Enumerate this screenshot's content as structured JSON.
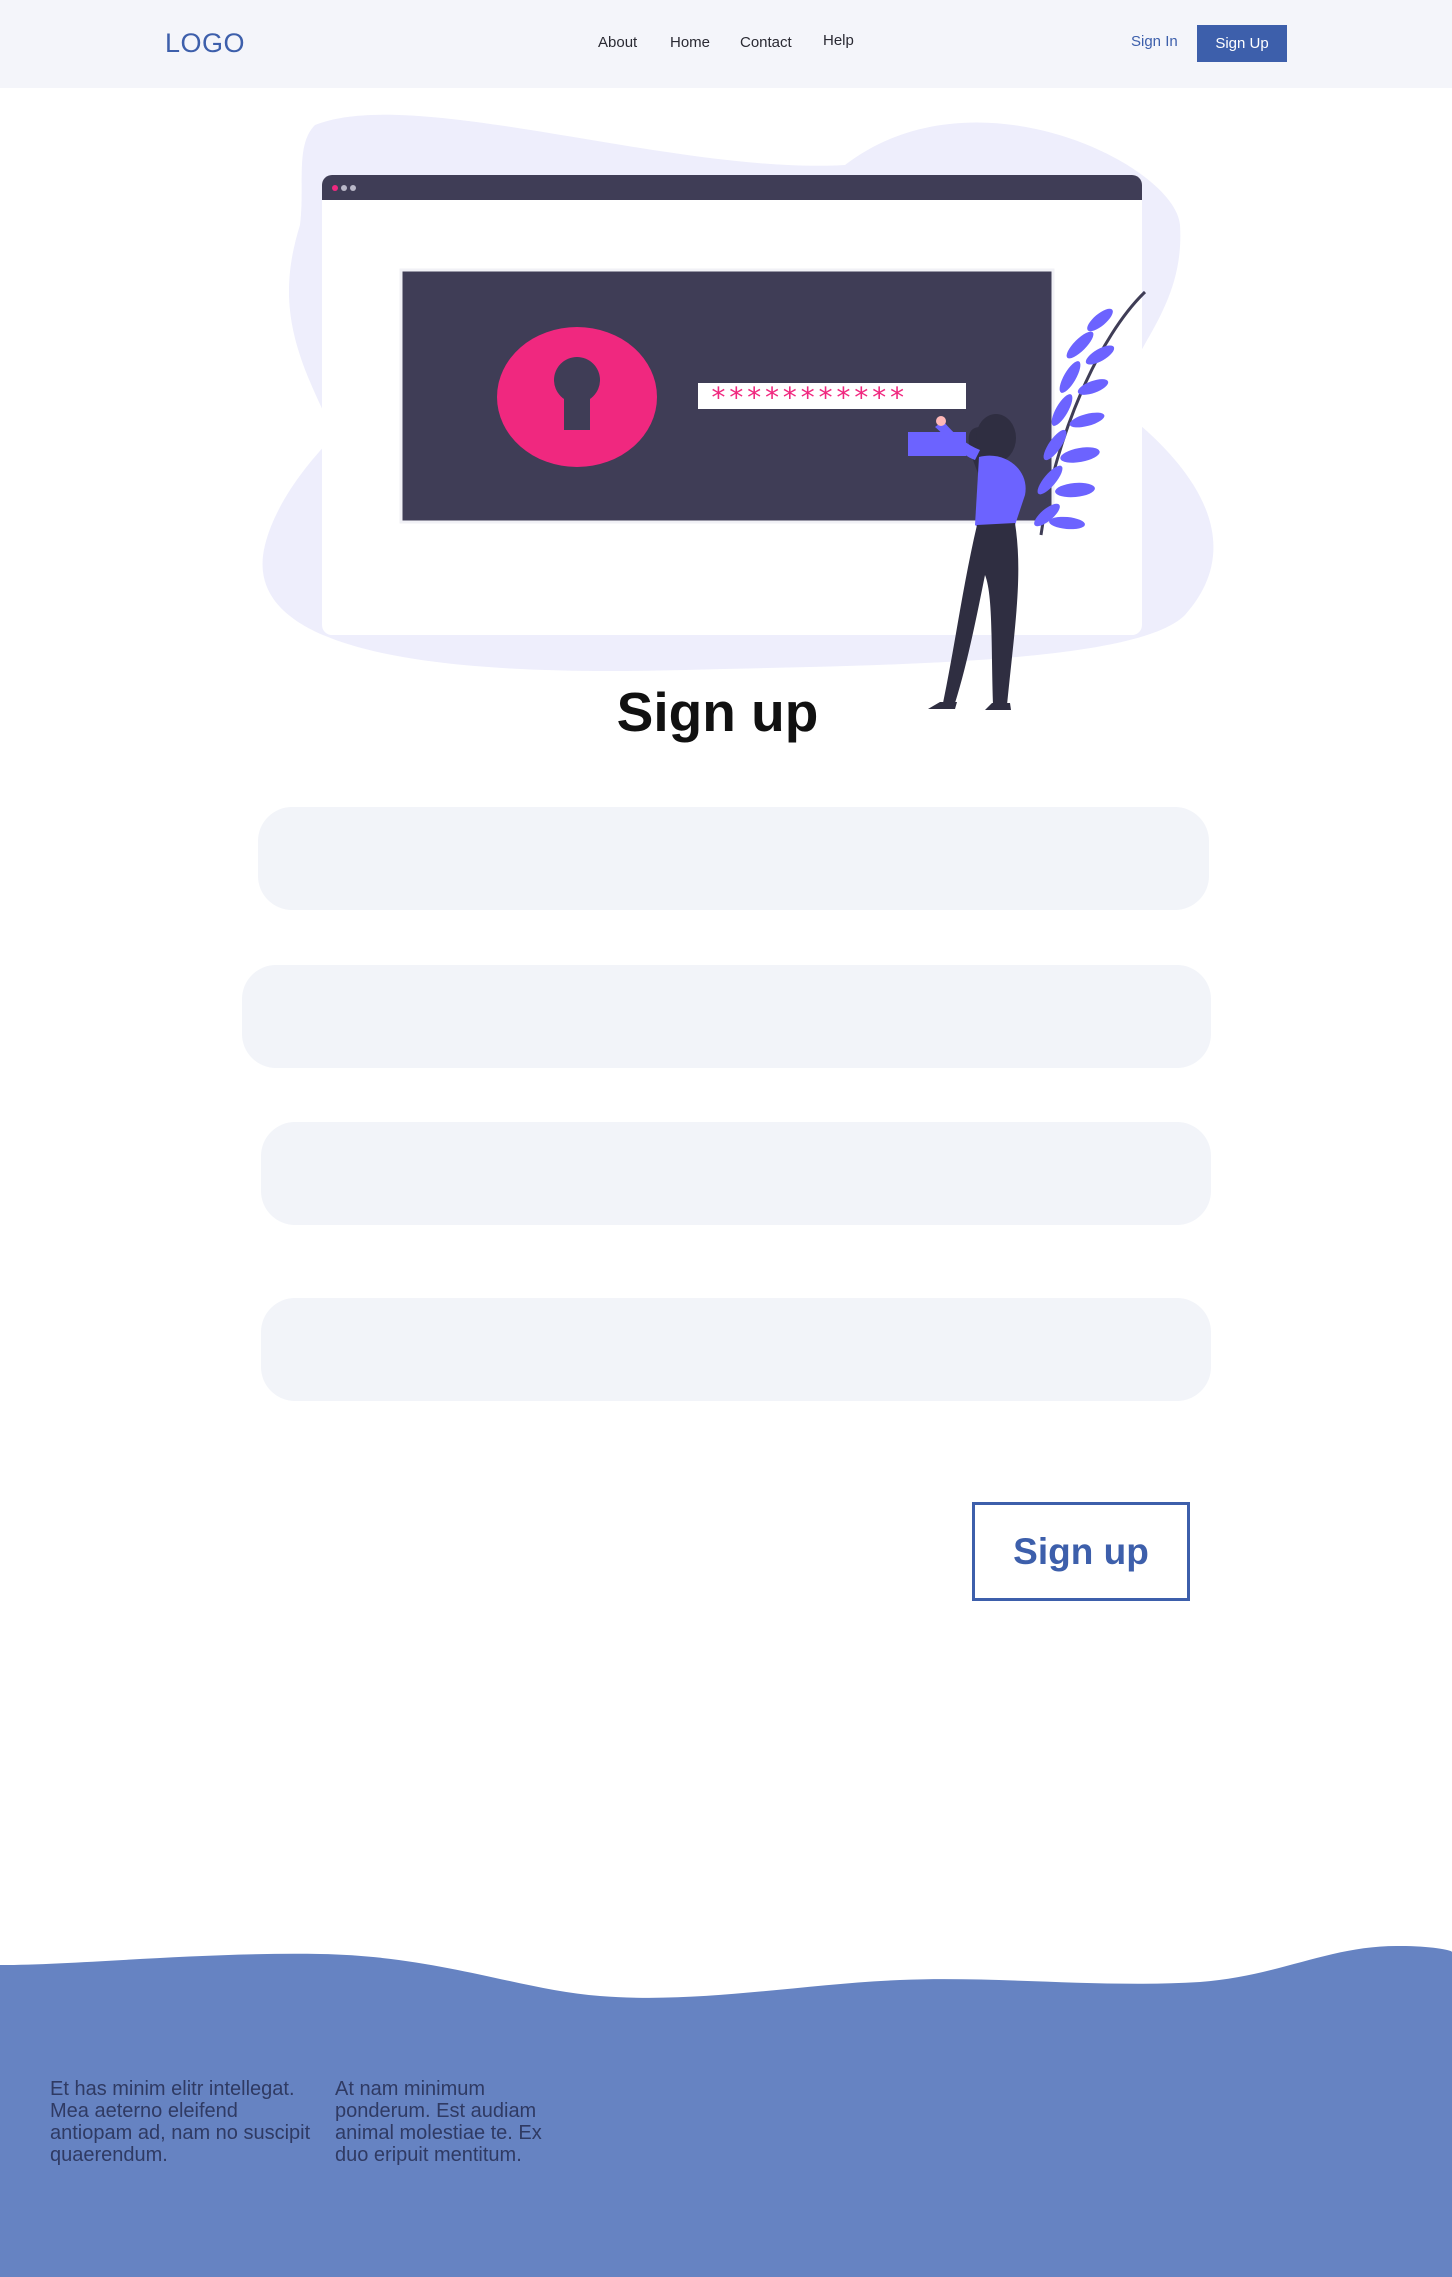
{
  "header": {
    "logo": "LOGO",
    "nav": [
      "About",
      "Home",
      "Contact",
      "Help"
    ],
    "sign_in": "Sign In",
    "sign_up": "Sign Up"
  },
  "hero": {
    "password_mask": "***********",
    "colors": {
      "blob": "#eeeefc",
      "screen": "#3f3d56",
      "accent": "#f0287f",
      "figure": "#6c63ff"
    }
  },
  "form": {
    "title": "Sign up",
    "submit_label": "Sign up"
  },
  "footer": {
    "col1": "Et has minim elitr intellegat. Mea aeterno eleifend antiopam ad, nam no suscipit quaerendum.",
    "col2": "At nam minimum ponderum. Est audiam animal molestiae te. Ex duo eripuit mentitum.",
    "bg_color": "#6683c2"
  }
}
